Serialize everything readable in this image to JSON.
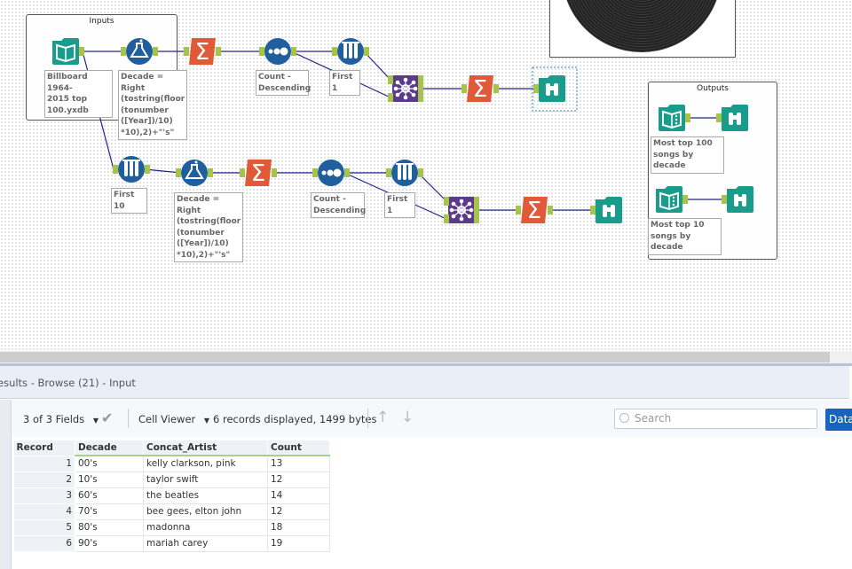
{
  "canvas": {
    "containers": {
      "inputs": "Inputs",
      "outputs": "Outputs"
    },
    "labels": {
      "input1": "Billboard 1964-\n2015 top\n100.yxdb",
      "formula1": "Decade = Right\n(tostring(floor\n(tonumber\n([Year])/10)\n*10),2)+\"'s\"",
      "sort1": "Count -\nDescending",
      "sample1": "First 1",
      "sample_first10": "First 10",
      "formula2": "Decade = Right\n(tostring(floor\n(tonumber\n([Year])/10)\n*10),2)+\"'s\"",
      "sort2": "Count -\nDescending",
      "sample2": "First 1",
      "out1": "Most top 100\nsongs by decade",
      "out2": "Most top 10\nsongs by decade"
    },
    "colors": {
      "teal": "#1a9c8c",
      "blue": "#1f5f9e",
      "orange": "#e05a3a",
      "purple": "#5b3a8c",
      "anchor": "#a6c44a",
      "connection": "#23238e"
    }
  },
  "results": {
    "title": "esults - Browse (21) - Input",
    "fields_selector": "3 of 3 Fields",
    "cell_viewer": "Cell Viewer",
    "summary": "6 records displayed, 1499 bytes",
    "search_placeholder": "Search",
    "data_button": "Data",
    "columns": [
      "Record",
      "Decade",
      "Concat_Artist",
      "Count"
    ],
    "rows": [
      [
        "1",
        "00's",
        "kelly clarkson, pink",
        "13"
      ],
      [
        "2",
        "10's",
        "taylor swift",
        "12"
      ],
      [
        "3",
        "60's",
        "the beatles",
        "14"
      ],
      [
        "4",
        "70's",
        "bee gees, elton john",
        "12"
      ],
      [
        "5",
        "80's",
        "madonna",
        "18"
      ],
      [
        "6",
        "90's",
        "mariah carey",
        "19"
      ]
    ]
  }
}
